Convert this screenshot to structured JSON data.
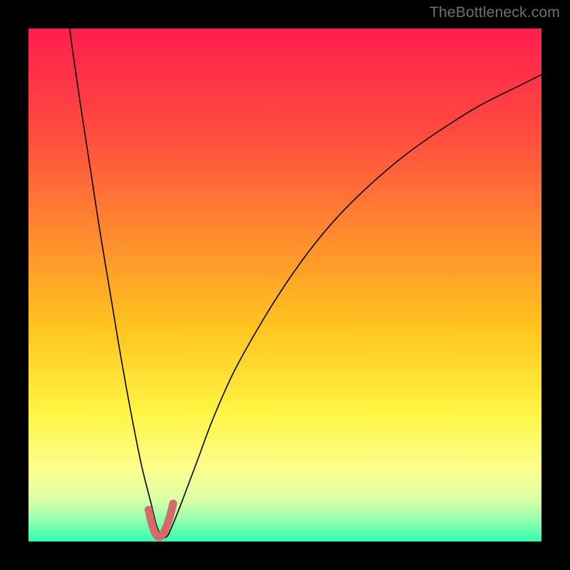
{
  "watermark": {
    "text": "TheBottleneck.com"
  },
  "chart_data": {
    "type": "line",
    "title": "",
    "xlabel": "",
    "ylabel": "",
    "xlim": [
      0,
      100
    ],
    "ylim": [
      0,
      100
    ],
    "grid": false,
    "legend": false,
    "background_gradient": {
      "stops": [
        {
          "pos": 0.0,
          "color": "#ff1e4e"
        },
        {
          "pos": 0.2,
          "color": "#ff4a3f"
        },
        {
          "pos": 0.4,
          "color": "#ff8a2f"
        },
        {
          "pos": 0.58,
          "color": "#ffc31f"
        },
        {
          "pos": 0.75,
          "color": "#fff544"
        },
        {
          "pos": 0.86,
          "color": "#fbff8f"
        },
        {
          "pos": 0.92,
          "color": "#d9ffa6"
        },
        {
          "pos": 0.96,
          "color": "#8fffb0"
        },
        {
          "pos": 1.0,
          "color": "#2dffb0"
        }
      ]
    },
    "series": [
      {
        "name": "bottleneck-curve",
        "color": "#000000",
        "width": 1.6,
        "x": [
          8,
          10,
          12,
          14,
          16,
          18,
          20,
          22,
          24,
          25,
          26,
          27,
          28,
          30,
          33,
          36,
          40,
          45,
          50,
          55,
          60,
          66,
          73,
          80,
          88,
          96,
          100
        ],
        "y": [
          100,
          86,
          73,
          60,
          48,
          36,
          25,
          15,
          7,
          3,
          1,
          1,
          3,
          8,
          16,
          24,
          33,
          42,
          50,
          57,
          63,
          69,
          75,
          80,
          85,
          89,
          91
        ]
      },
      {
        "name": "highlight-segment",
        "color": "#d46a6a",
        "width": 11,
        "x": [
          23.4,
          24.0,
          24.6,
          25.2,
          25.8,
          26.4,
          27.0,
          27.6,
          28.2
        ],
        "y": [
          6.2,
          3.6,
          1.8,
          1.0,
          1.0,
          1.8,
          3.2,
          5.0,
          7.4
        ]
      }
    ]
  }
}
